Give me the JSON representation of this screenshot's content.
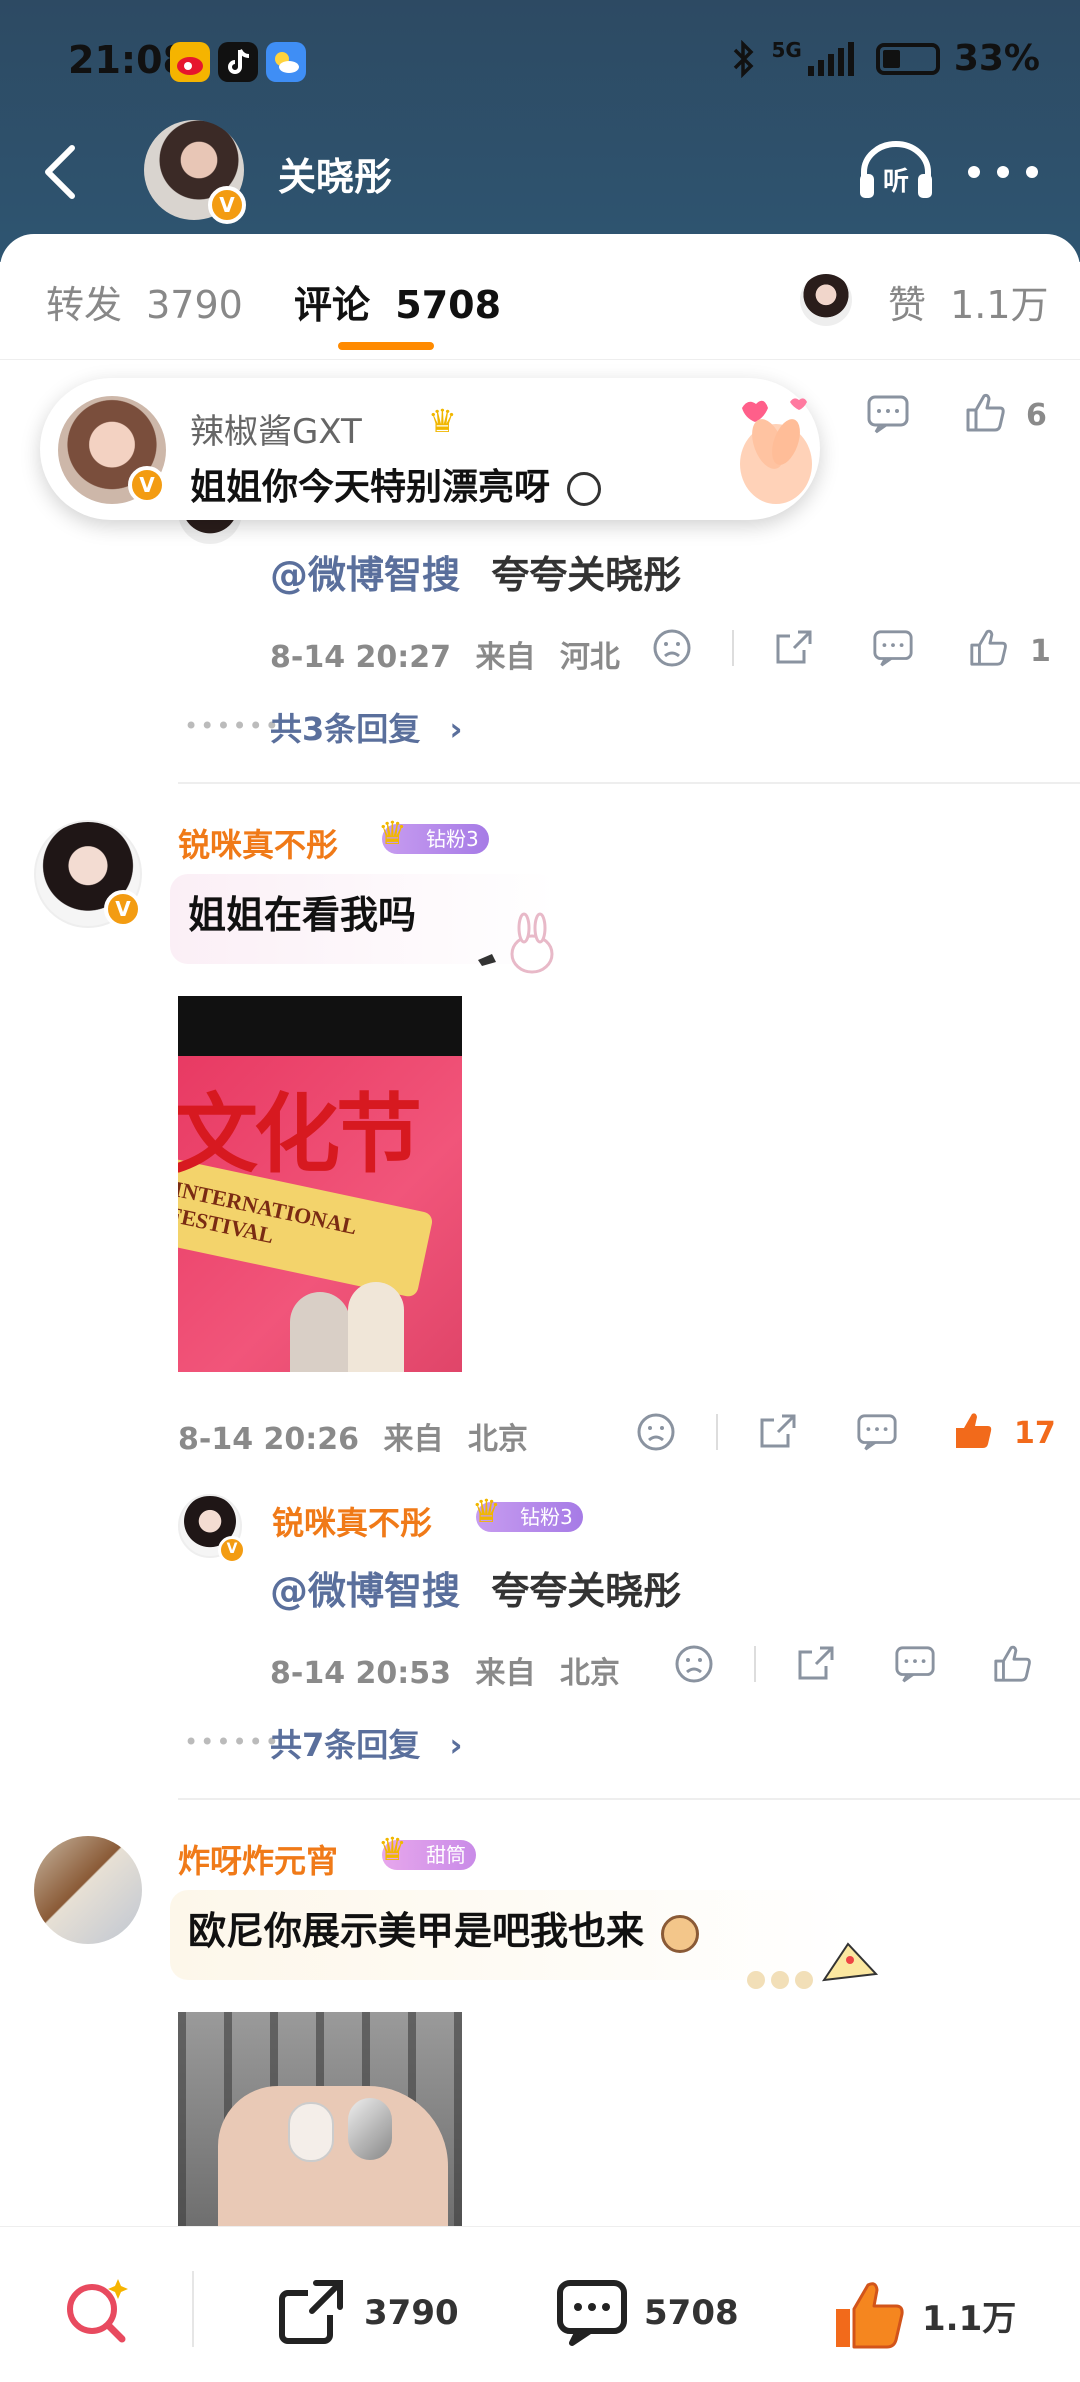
{
  "status_bar": {
    "time": "21:08",
    "network": "5G",
    "battery": "33%"
  },
  "nav": {
    "title": "关晓彤"
  },
  "tabs": {
    "repost_label": "转发",
    "repost_count": "3790",
    "comment_label": "评论",
    "comment_count": "5708",
    "like_label": "赞",
    "like_count": "1.1万"
  },
  "toast": {
    "name": "辣椒酱GXT",
    "text": "姐姐你今天特别漂亮呀"
  },
  "comment_top": {
    "like_count": "6",
    "reply_mention": "@微博智搜",
    "reply_text": "夸夸关晓彤",
    "reply_date": "8-14 20:27",
    "reply_from": "来自",
    "reply_location": "河北",
    "reply_like_count": "1",
    "more_replies": "共3条回复"
  },
  "comment_1": {
    "username": "锐咪真不彤",
    "badge": "钻粉3",
    "text": "姐姐在看我吗",
    "photo_banner": "文化节",
    "photo_festival": "INTERNATIONAL FESTIVAL",
    "date": "8-14 20:26",
    "from": "来自",
    "location": "北京",
    "like_count": "17",
    "reply": {
      "username": "锐咪真不彤",
      "badge": "钻粉3",
      "mention": "@微博智搜",
      "text": "夸夸关晓彤",
      "date": "8-14 20:53",
      "from": "来自",
      "location": "北京"
    },
    "more_replies": "共7条回复"
  },
  "comment_2": {
    "username": "炸呀炸元宵",
    "badge": "甜筒",
    "text": "欧尼你展示美甲是吧我也来"
  },
  "bottom_bar": {
    "repost_count": "3790",
    "comment_count": "5708",
    "like_count": "1.1万"
  },
  "colors": {
    "header_bg": "#2d4a63",
    "accent_orange": "#ff8a00",
    "username_orange": "#f07a18",
    "mention_blue": "#5a6f9c",
    "like_active": "#f26a1b"
  }
}
